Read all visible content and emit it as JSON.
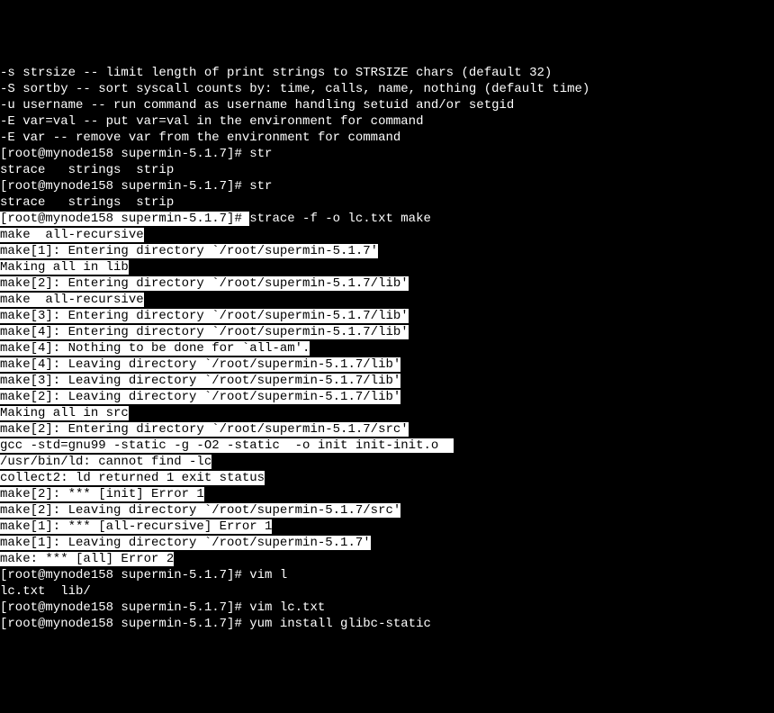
{
  "lines": [
    {
      "text": "-s strsize -- limit length of print strings to STRSIZE chars (default 32)",
      "inv": false
    },
    {
      "text": "-S sortby -- sort syscall counts by: time, calls, name, nothing (default time)",
      "inv": false
    },
    {
      "text": "-u username -- run command as username handling setuid and/or setgid",
      "inv": false
    },
    {
      "text": "-E var=val -- put var=val in the environment for command",
      "inv": false
    },
    {
      "text": "-E var -- remove var from the environment for command",
      "inv": false
    },
    {
      "text": "[root@mynode158 supermin-5.1.7]# str",
      "inv": false
    },
    {
      "text": "strace   strings  strip",
      "inv": false
    },
    {
      "text": "[root@mynode158 supermin-5.1.7]# str",
      "inv": false
    },
    {
      "text": "strace   strings  strip",
      "inv": false
    },
    {
      "segments": [
        {
          "text": "[root@mynode158 supermin-5.1.7]# ",
          "inv": true
        },
        {
          "text": "strace -f -o lc.txt make",
          "inv": false
        }
      ]
    },
    {
      "text": "make  all-recursive",
      "inv": true
    },
    {
      "text": "make[1]: Entering directory `/root/supermin-5.1.7'",
      "inv": true
    },
    {
      "text": "Making all in lib",
      "inv": true
    },
    {
      "text": "make[2]: Entering directory `/root/supermin-5.1.7/lib'",
      "inv": true
    },
    {
      "text": "make  all-recursive",
      "inv": true
    },
    {
      "text": "make[3]: Entering directory `/root/supermin-5.1.7/lib'",
      "inv": true
    },
    {
      "text": "make[4]: Entering directory `/root/supermin-5.1.7/lib'",
      "inv": true
    },
    {
      "text": "make[4]: Nothing to be done for `all-am'.",
      "inv": true
    },
    {
      "text": "make[4]: Leaving directory `/root/supermin-5.1.7/lib'",
      "inv": true
    },
    {
      "text": "make[3]: Leaving directory `/root/supermin-5.1.7/lib'",
      "inv": true
    },
    {
      "text": "make[2]: Leaving directory `/root/supermin-5.1.7/lib'",
      "inv": true
    },
    {
      "text": "Making all in src",
      "inv": true
    },
    {
      "text": "make[2]: Entering directory `/root/supermin-5.1.7/src'",
      "inv": true
    },
    {
      "text": "gcc -std=gnu99 -static -g -O2 -static  -o init init-init.o  ",
      "inv": true
    },
    {
      "text": "/usr/bin/ld: cannot find -lc",
      "inv": true
    },
    {
      "text": "collect2: ld returned 1 exit status",
      "inv": true
    },
    {
      "text": "make[2]: *** [init] Error 1",
      "inv": true
    },
    {
      "text": "make[2]: Leaving directory `/root/supermin-5.1.7/src'",
      "inv": true
    },
    {
      "text": "make[1]: *** [all-recursive] Error 1",
      "inv": true
    },
    {
      "text": "make[1]: Leaving directory `/root/supermin-5.1.7'",
      "inv": true
    },
    {
      "text": "make: *** [all] Error 2",
      "inv": true
    },
    {
      "text": "[root@mynode158 supermin-5.1.7]# vim l",
      "inv": false
    },
    {
      "text": "lc.txt  lib/",
      "inv": false
    },
    {
      "text": "[root@mynode158 supermin-5.1.7]# vim lc.txt ",
      "inv": false
    },
    {
      "text": "[root@mynode158 supermin-5.1.7]# yum install glibc-static",
      "inv": false
    }
  ]
}
